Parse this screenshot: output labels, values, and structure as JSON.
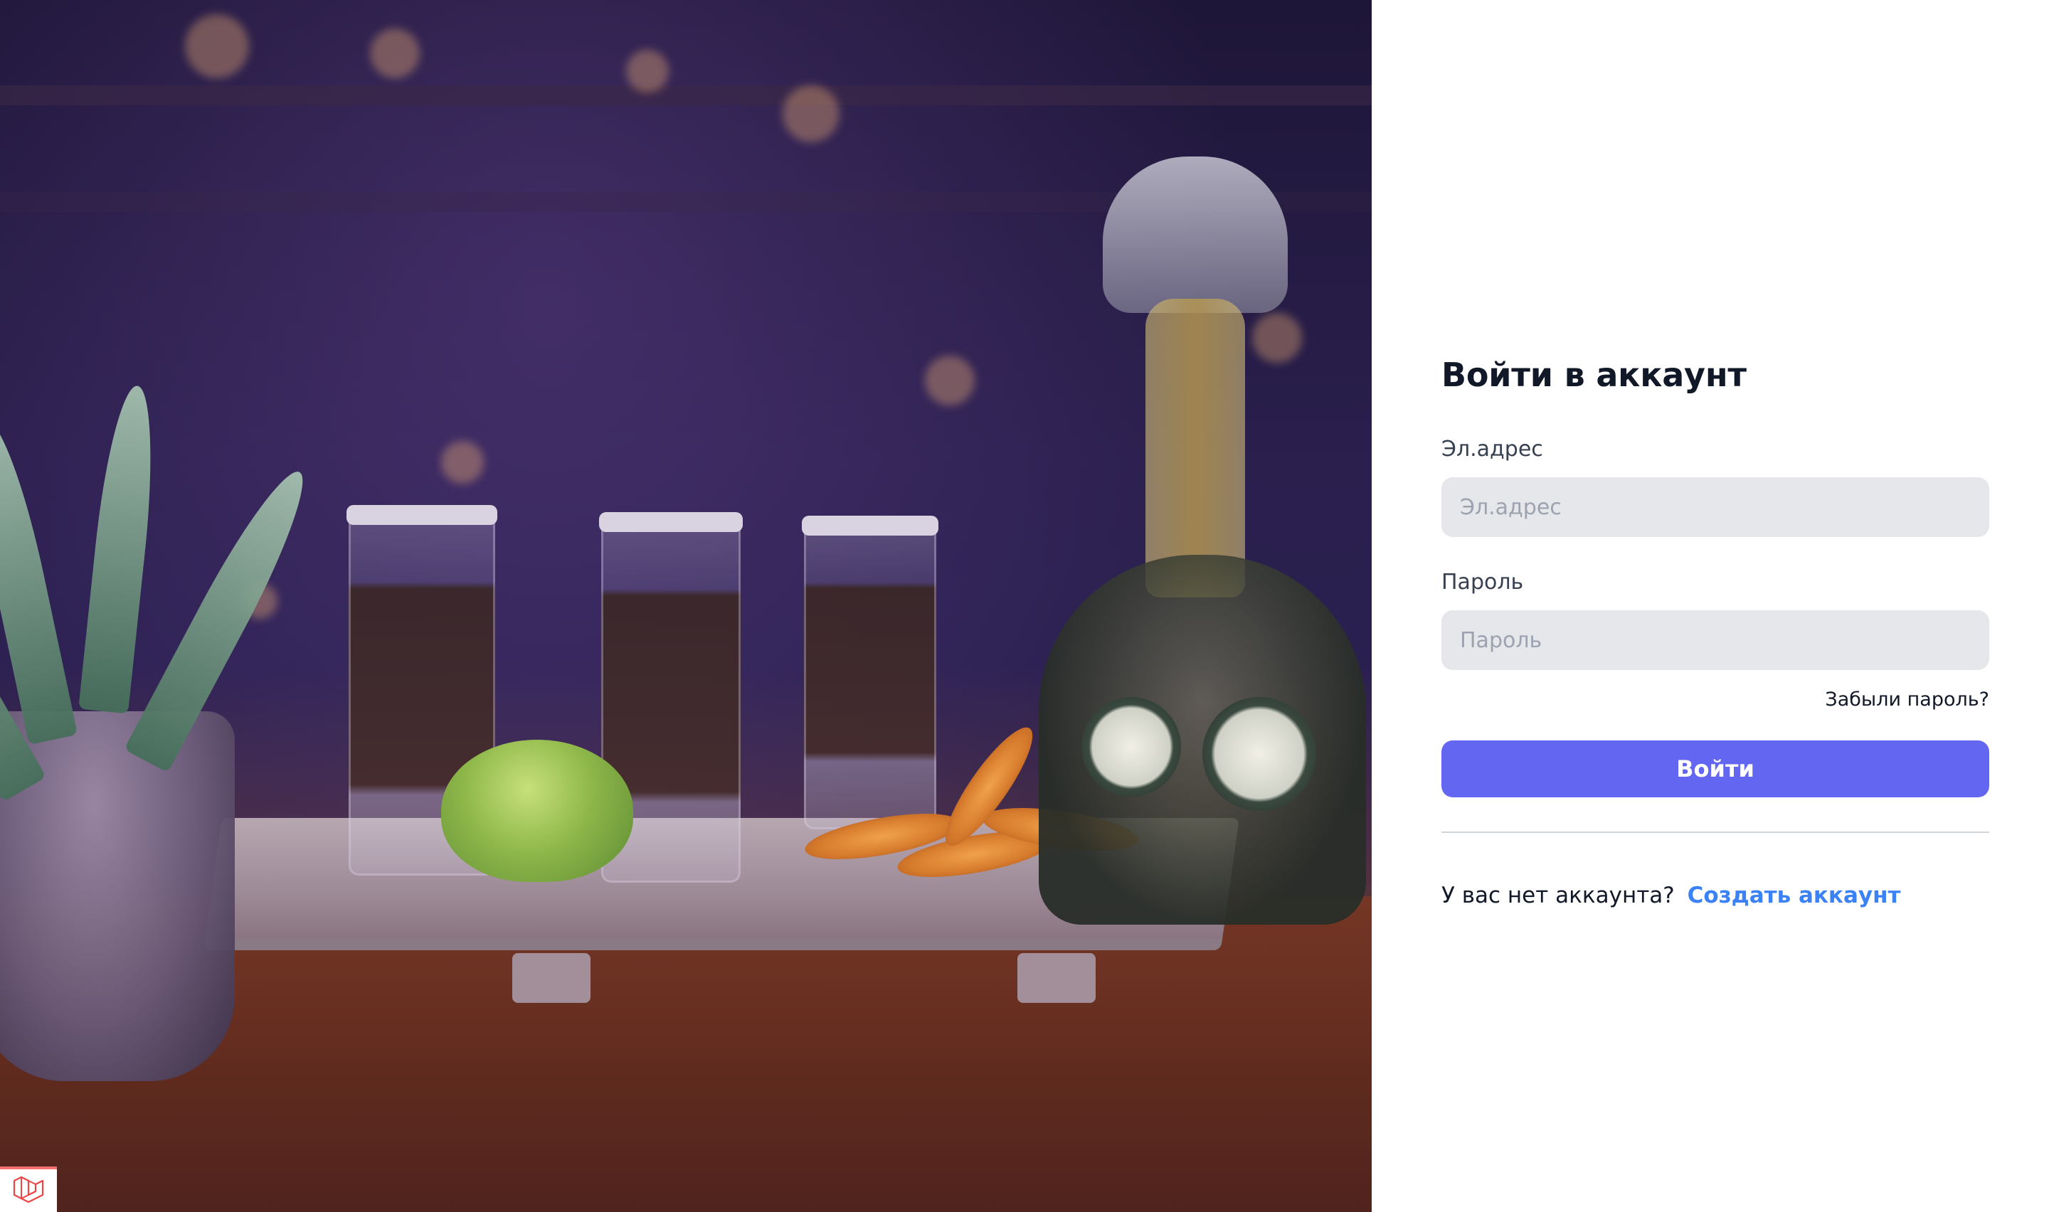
{
  "login": {
    "title": "Войти в аккаунт",
    "email_label": "Эл.адрес",
    "email_placeholder": "Эл.адрес",
    "email_value": "",
    "password_label": "Пароль",
    "password_placeholder": "Пароль",
    "password_value": "",
    "forgot_password": "Забыли пароль?",
    "submit_label": "Войти",
    "no_account_text": "У вас нет аккаунта?",
    "create_account_link": "Создать аккаунт"
  },
  "hero": {
    "image_alt": "bar-photo"
  },
  "corner": {
    "icon": "laravel-logo-icon"
  },
  "colors": {
    "primary_button": "#6366f1",
    "link": "#3b82f6",
    "input_bg": "#e5e7eb",
    "divider": "#d1d5db",
    "hero_overlay": "#2a1f4d"
  }
}
